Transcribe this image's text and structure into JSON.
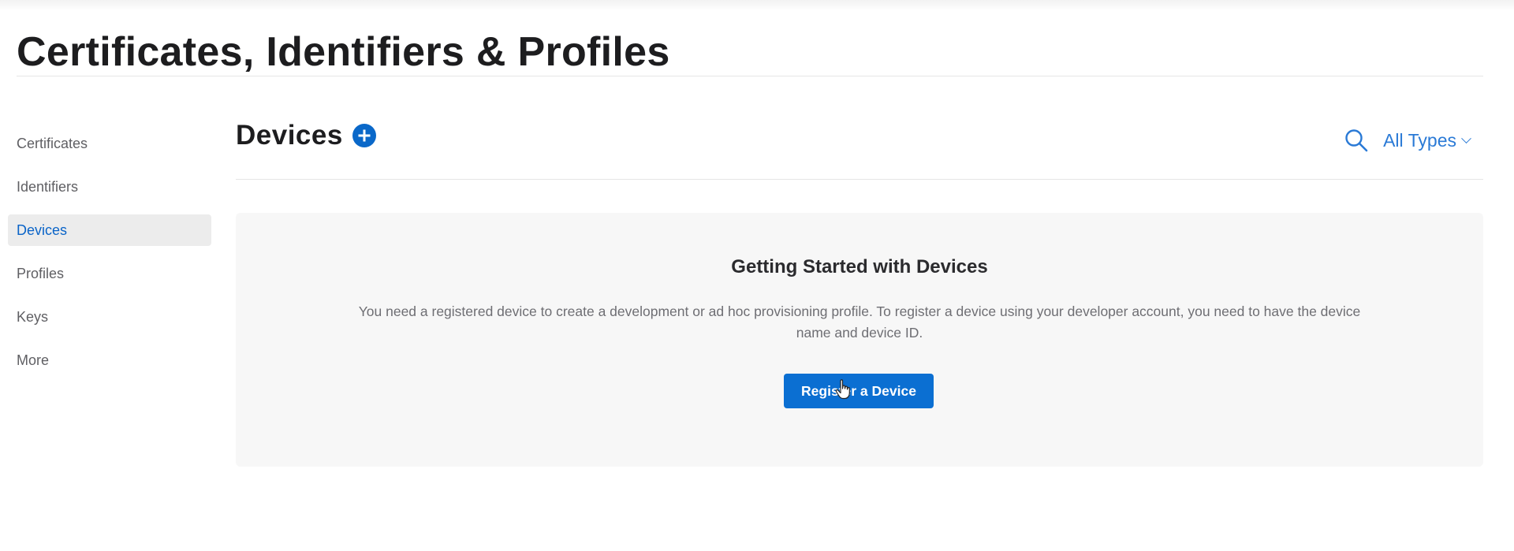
{
  "header": {
    "title": "Certificates, Identifiers & Profiles"
  },
  "sidebar": {
    "items": [
      {
        "label": "Certificates",
        "active": false
      },
      {
        "label": "Identifiers",
        "active": false
      },
      {
        "label": "Devices",
        "active": true
      },
      {
        "label": "Profiles",
        "active": false
      },
      {
        "label": "Keys",
        "active": false
      },
      {
        "label": "More",
        "active": false
      }
    ]
  },
  "main": {
    "section_title": "Devices",
    "add_icon": "plus-circle-icon",
    "search_icon": "search-icon",
    "filter": {
      "selected": "All Types",
      "icon": "chevron-down-icon"
    },
    "empty_state": {
      "heading": "Getting Started with Devices",
      "body": "You need a registered device to create a development or ad hoc provisioning profile. To register a device using your developer account, you need to have the device name and device ID.",
      "button_label": "Register a Device"
    }
  },
  "colors": {
    "accent": "#0b6fd2",
    "link": "#2a7ad6",
    "active_bg": "#ececec",
    "panel_bg": "#f7f7f7"
  }
}
